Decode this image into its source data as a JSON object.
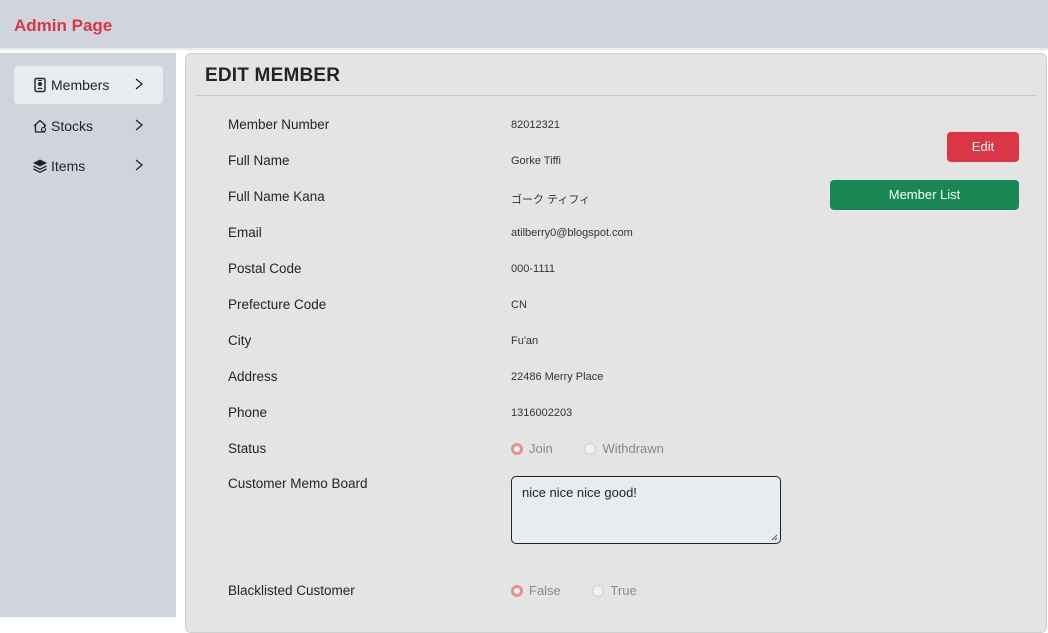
{
  "app": {
    "title": "Admin Page"
  },
  "sidebar": {
    "items": [
      {
        "label": "Members",
        "icon": "person-badge-icon",
        "active": true
      },
      {
        "label": "Stocks",
        "icon": "house-gear-icon",
        "active": false
      },
      {
        "label": "Items",
        "icon": "stack-icon",
        "active": false
      }
    ]
  },
  "page": {
    "title": "EDIT MEMBER"
  },
  "fields": {
    "member_number": {
      "label": "Member Number",
      "value": "82012321"
    },
    "full_name": {
      "label": "Full Name",
      "value": "Gorke Tiffi"
    },
    "full_name_kana": {
      "label": "Full Name Kana",
      "value": "ゴーク ティフィ"
    },
    "email": {
      "label": "Email",
      "value": "atilberry0@blogspot.com"
    },
    "postal_code": {
      "label": "Postal Code",
      "value": "000-1111"
    },
    "prefecture_code": {
      "label": "Prefecture Code",
      "value": "CN"
    },
    "city": {
      "label": "City",
      "value": "Fu'an"
    },
    "address": {
      "label": "Address",
      "value": "22486 Merry Place"
    },
    "phone": {
      "label": "Phone",
      "value": "1316002203"
    },
    "status": {
      "label": "Status",
      "options": [
        "Join",
        "Withdrawn"
      ],
      "selected": "Join"
    },
    "memo": {
      "label": "Customer Memo Board",
      "value": "nice nice nice good!"
    },
    "blacklisted": {
      "label": "Blacklisted Customer",
      "options": [
        "False",
        "True"
      ],
      "selected": "False"
    }
  },
  "actions": {
    "edit_label": "Edit",
    "member_list_label": "Member List"
  },
  "colors": {
    "brand": "#dc3545",
    "edit": "#dc3545",
    "member_list": "#198754",
    "radio_selected": "#f08a8a"
  }
}
